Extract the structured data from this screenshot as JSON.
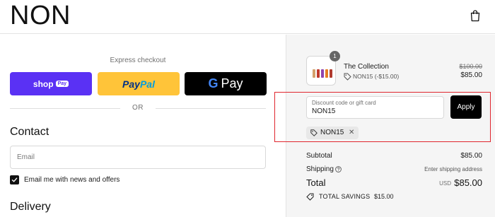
{
  "header": {
    "logo": "NON",
    "cart_icon": "shopping-bag-icon"
  },
  "express": {
    "title": "Express checkout",
    "shop_label": "shop",
    "shop_pill": "Pay",
    "paypal_part1": "Pay",
    "paypal_part2": "Pal",
    "gpay_g": "G",
    "gpay_label": "Pay",
    "or_text": "OR"
  },
  "contact": {
    "title": "Contact",
    "email_placeholder": "Email",
    "news_label": "Email me with news and offers",
    "news_checked": true
  },
  "delivery": {
    "title": "Delivery"
  },
  "order": {
    "product_name": "The Collection",
    "quantity": "1",
    "discount_applied": "NON15 (-$15.00)",
    "price_original": "$100.00",
    "price_final": "$85.00"
  },
  "discount": {
    "label": "Discount code or gift card",
    "value": "NON15",
    "apply_label": "Apply",
    "chip_code": "NON15"
  },
  "summary": {
    "subtotal_label": "Subtotal",
    "subtotal_value": "$85.00",
    "shipping_label": "Shipping",
    "shipping_value": "Enter shipping address",
    "total_label": "Total",
    "total_currency": "USD",
    "total_value": "$85.00",
    "savings_label": "TOTAL SAVINGS",
    "savings_value": "$15.00"
  },
  "colors": {
    "shop_pay": "#5a31f4",
    "paypal": "#ffc439",
    "highlight": "#e0262e"
  }
}
